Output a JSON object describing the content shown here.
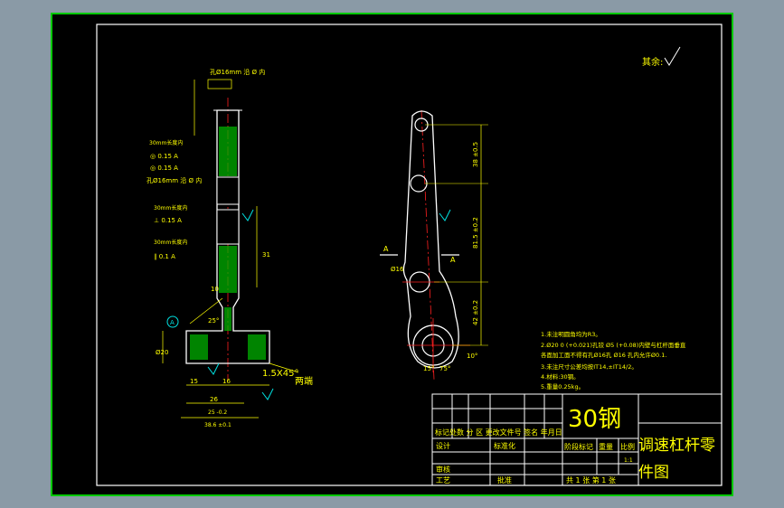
{
  "colors": {
    "background": "#8a9aa6",
    "sheet": "#000000",
    "frame": "#00c800",
    "outline": "#ffffff",
    "dimension": "#ffff00",
    "center_line": "#ff2020",
    "hatch": "#00b000",
    "symbol": "#00e0e0"
  },
  "surface_note": "其余:",
  "material": "30钢",
  "drawing_title_line1": "调速杠杆零",
  "drawing_title_line2": "件图",
  "title_block": {
    "row_changes": "标记处数 分 区 更改文件号 签名 年月日",
    "design": "设计",
    "standardization": "标准化",
    "stage_marks": "阶段标记",
    "weight": "重量",
    "scale_label": "比例",
    "scale_value": "1:1",
    "review": "审核",
    "process": "工艺",
    "approve": "批准",
    "sheet_count": "共 1 张 第 1 张"
  },
  "tech_notes": [
    "1.未注明圆角均为R3。",
    "2.Ø20 0 (+0.021)孔铰 Ø5 (+0.08)内壁与杠杆面垂直",
    "  各面加工面不得有孔Ø16孔 Ø16 孔内允许Ø0.1.",
    "3.未注尺寸公差均按IT14,±IT14/2。",
    "4.材料:30钢。",
    "5.重量0.25kg。"
  ],
  "side_view": {
    "top_note": "孔Ø16mm 沿 Ø 内",
    "hole_note": "孔Ø16mm 沿 Ø 内",
    "frame_a": "◎ 0.15 A",
    "frame_b": "⊥ 0.15 A",
    "frame_c": "∥ 0.1 A",
    "label_30": "30mm长度内",
    "label_10": "10",
    "label_31": "31",
    "label_26": "26",
    "label_16": "16",
    "label_15": "15",
    "label_25": "25 -0.2",
    "label_38": "38.6 ±0.1",
    "label_20": "Ø20",
    "label_chamfer": "1.5X45°",
    "label_both": "两端",
    "label_angle": "25°",
    "datum": "A"
  },
  "front_view": {
    "dim_top": "38 ±0.5",
    "dim_mid": "81.5 ±0.2",
    "dim_low": "42 ±0.2",
    "label_phi": "Ø16",
    "section": "A",
    "angle_a": "15°",
    "angle_b": "75°",
    "angle_c": "10°"
  }
}
